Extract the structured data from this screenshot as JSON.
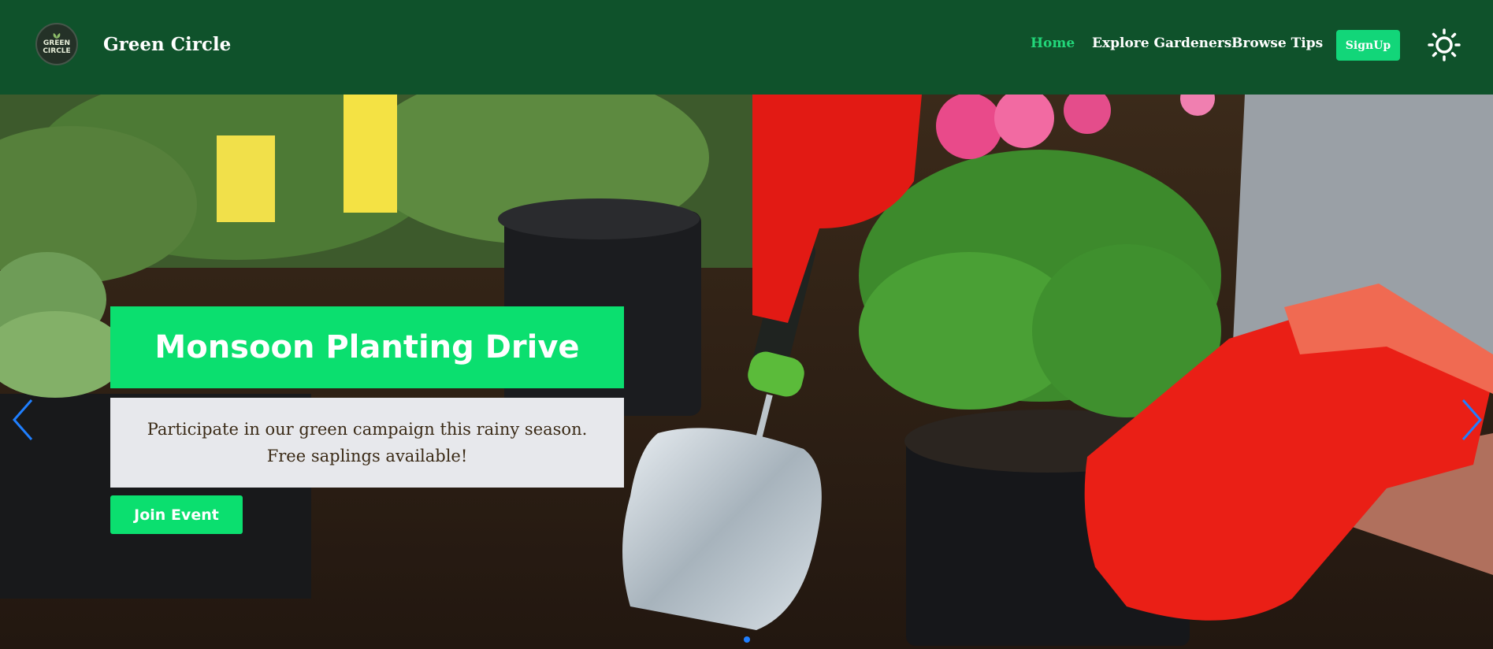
{
  "navbar": {
    "logo_lines": [
      "GREEN",
      "CIRCLE"
    ],
    "brand_name": "Green Circle",
    "links": [
      "Home",
      "Explore Gardeners",
      "Browse Tips"
    ],
    "signup_label": "SignUp",
    "theme_icon": "sun-icon",
    "colors": {
      "background": "#0f522b",
      "active_link": "#22d679",
      "button": "#12d679"
    }
  },
  "hero": {
    "title": "Monsoon Planting Drive",
    "description_line1": "Participate in our green campaign this rainy season.",
    "description_line2": "Free saplings available!",
    "button_label": "Join Event",
    "prev_icon": "chevron-left-icon",
    "next_icon": "chevron-right-icon",
    "slide_indicator_icon": "dot-indicator-icon",
    "colors": {
      "accent": "#0bdf6f",
      "description_bg": "#e7e8ec",
      "arrows": "#1f7fff"
    }
  }
}
